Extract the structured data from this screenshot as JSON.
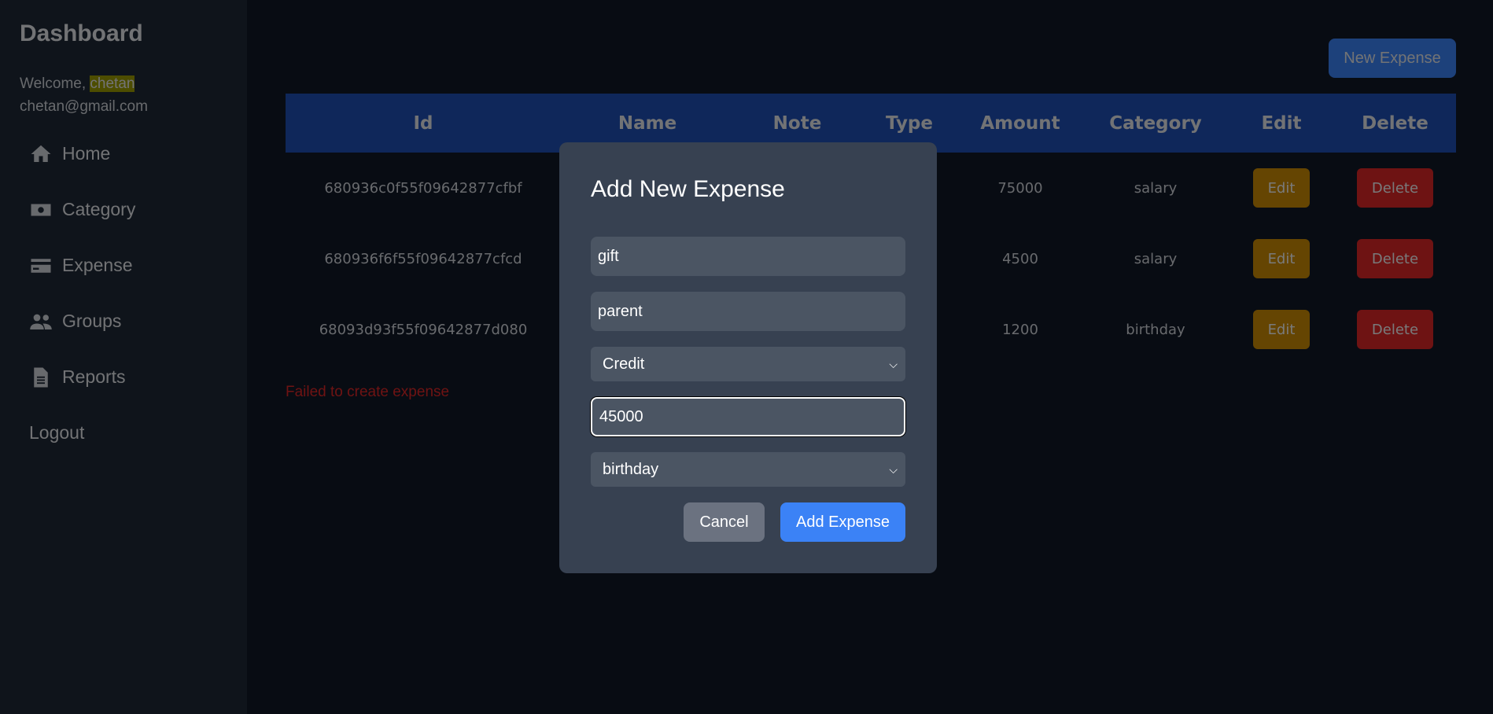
{
  "sidebar": {
    "title": "Dashboard",
    "welcome_prefix": "Welcome, ",
    "username": "chetan",
    "email": "chetan@gmail.com",
    "items": [
      {
        "label": "Home",
        "icon": "home-icon"
      },
      {
        "label": "Category",
        "icon": "money-icon"
      },
      {
        "label": "Expense",
        "icon": "card-icon"
      },
      {
        "label": "Groups",
        "icon": "users-icon"
      },
      {
        "label": "Reports",
        "icon": "file-icon"
      }
    ],
    "logout": "Logout"
  },
  "header": {
    "new_expense": "New Expense"
  },
  "table": {
    "columns": [
      "Id",
      "Name",
      "Note",
      "Type",
      "Amount",
      "Category",
      "Edit",
      "Delete"
    ],
    "rows": [
      {
        "id": "680936c0f55f09642877cfbf",
        "name": "",
        "note": "",
        "type": "",
        "amount": "75000",
        "category": "salary",
        "edit": "Edit",
        "delete": "Delete"
      },
      {
        "id": "680936f6f55f09642877cfcd",
        "name": "",
        "note": "",
        "type": "",
        "amount": "4500",
        "category": "salary",
        "edit": "Edit",
        "delete": "Delete"
      },
      {
        "id": "68093d93f55f09642877d080",
        "name": "",
        "note": "",
        "type": "",
        "amount": "1200",
        "category": "birthday",
        "edit": "Edit",
        "delete": "Delete"
      }
    ]
  },
  "error_message": "Failed to create expense",
  "modal": {
    "title": "Add New Expense",
    "name_value": "gift",
    "note_value": "parent",
    "type_selected": "Credit",
    "amount_value": "45000",
    "category_selected": "birthday",
    "cancel": "Cancel",
    "submit": "Add Expense"
  },
  "colors": {
    "background": "#111827",
    "sidebar": "#1f2937",
    "table_header": "#1e4fb4",
    "primary": "#3b82f6",
    "edit": "#ca8a04",
    "delete": "#dc2626",
    "modal": "#374151"
  }
}
